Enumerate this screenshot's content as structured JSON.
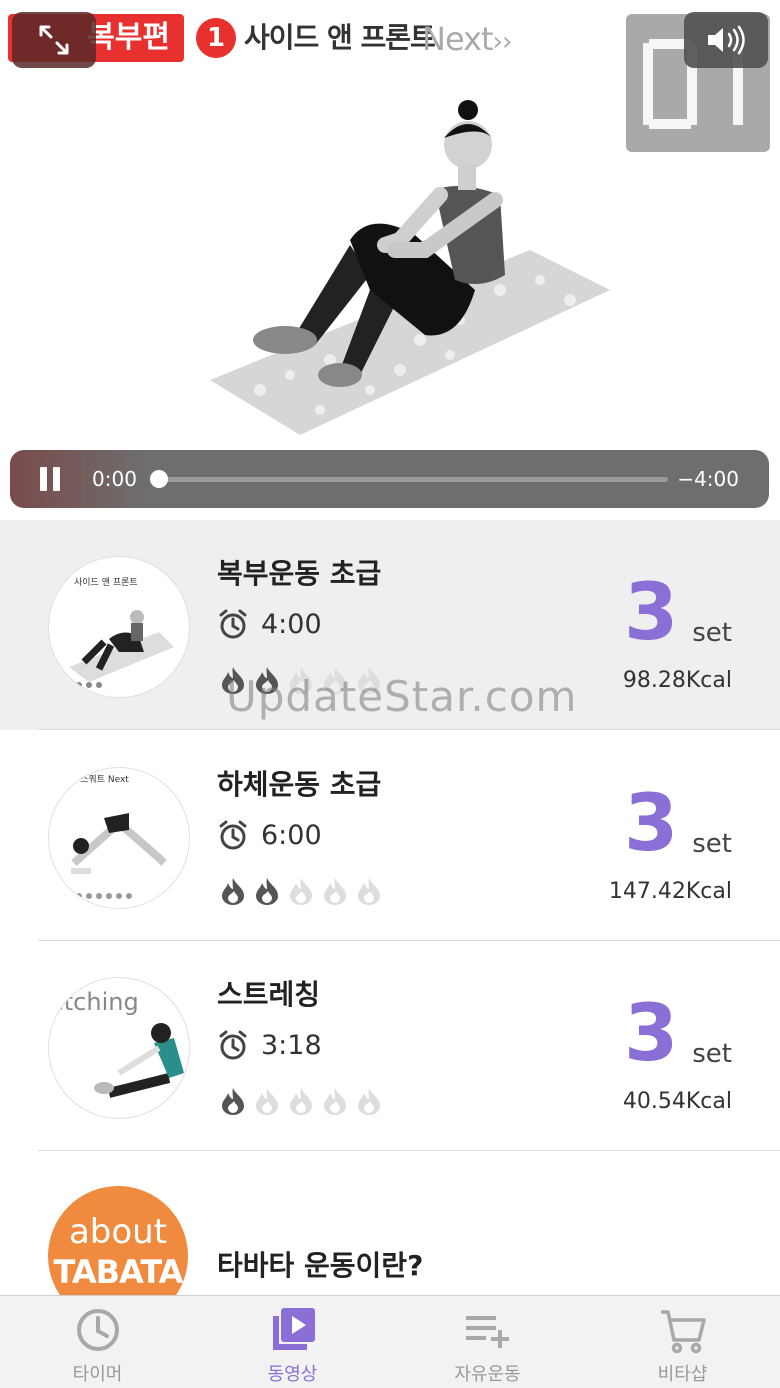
{
  "video": {
    "category": "복부편",
    "step_number": "1",
    "exercise_title": "사이드 앤 프론트",
    "next_label": "Next",
    "next_arrows": "››",
    "current_time": "0:00",
    "remaining_time": "−4:00",
    "progress": 0.0
  },
  "workouts": [
    {
      "title": "복부운동 초급",
      "duration": "4:00",
      "intensity": 2,
      "sets": "3",
      "set_unit": "set",
      "kcal": "98.28Kcal",
      "thumb_caption": "사이드 앤 프론트",
      "selected": true
    },
    {
      "title": "하체운동 초급",
      "duration": "6:00",
      "intensity": 2,
      "sets": "3",
      "set_unit": "set",
      "kcal": "147.42Kcal",
      "thumb_caption": "루 스쿼트 Next",
      "selected": false
    },
    {
      "title": "스트레칭",
      "duration": "3:18",
      "intensity": 1,
      "sets": "3",
      "set_unit": "set",
      "kcal": "40.54Kcal",
      "thumb_caption": "etching",
      "selected": false
    }
  ],
  "about": {
    "logo_line1": "about",
    "logo_line2": "TABATA",
    "title": "타바타 운동이란?"
  },
  "watermark": "UpdateStar.com",
  "tabs": [
    {
      "label": "타이머",
      "icon": "clock-icon",
      "active": false
    },
    {
      "label": "동영상",
      "icon": "video-library-icon",
      "active": true
    },
    {
      "label": "자유운동",
      "icon": "playlist-add-icon",
      "active": false
    },
    {
      "label": "비타샵",
      "icon": "cart-icon",
      "active": false
    }
  ],
  "colors": {
    "accent": "#8a6fd6",
    "red_label": "#e8302f",
    "flame_on": "#555555",
    "flame_off": "#dddddd",
    "about_orange": "#ef8a3e"
  }
}
